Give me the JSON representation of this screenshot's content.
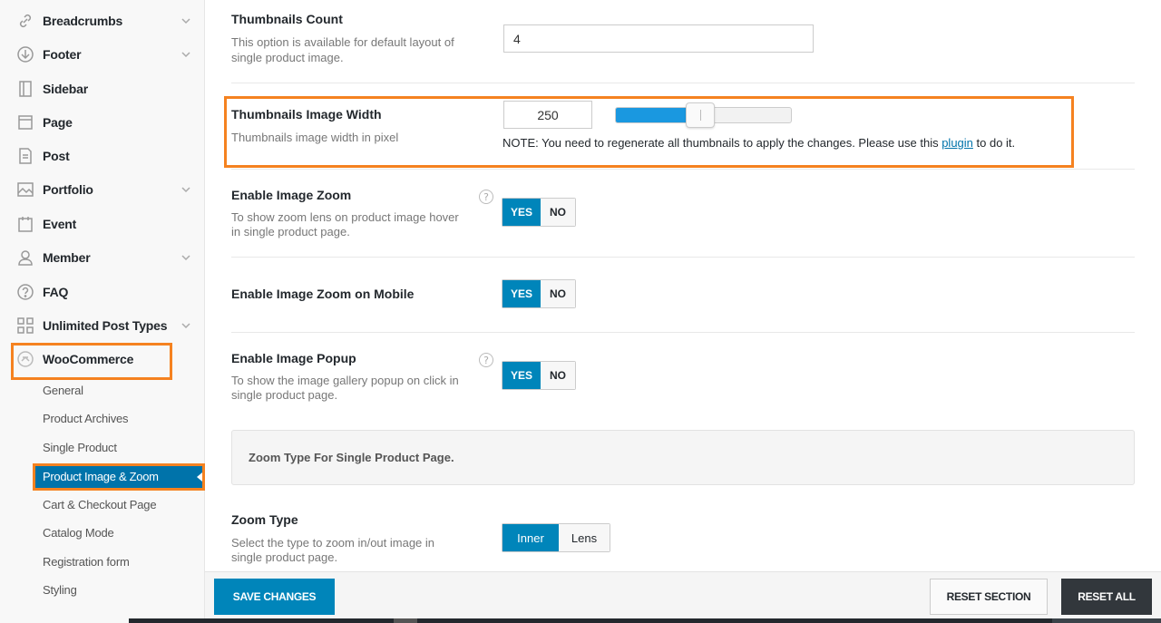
{
  "sidebar": {
    "items": [
      {
        "label": "Breadcrumbs",
        "icon": "link-icon",
        "has_chevron": true
      },
      {
        "label": "Footer",
        "icon": "arrow-down-circle-icon",
        "has_chevron": true
      },
      {
        "label": "Sidebar",
        "icon": "sidebar-icon",
        "has_chevron": false
      },
      {
        "label": "Page",
        "icon": "page-icon",
        "has_chevron": false
      },
      {
        "label": "Post",
        "icon": "post-icon",
        "has_chevron": false
      },
      {
        "label": "Portfolio",
        "icon": "image-icon",
        "has_chevron": true
      },
      {
        "label": "Event",
        "icon": "calendar-icon",
        "has_chevron": false
      },
      {
        "label": "Member",
        "icon": "user-icon",
        "has_chevron": true
      },
      {
        "label": "FAQ",
        "icon": "question-circle-icon",
        "has_chevron": false
      },
      {
        "label": "Unlimited Post Types",
        "icon": "grid-icon",
        "has_chevron": true
      },
      {
        "label": "WooCommerce",
        "icon": "woocommerce-icon",
        "has_chevron": false
      }
    ],
    "subitems": [
      "General",
      "Product Archives",
      "Single Product",
      "Product Image & Zoom",
      "Cart & Checkout Page",
      "Catalog Mode",
      "Registration form",
      "Styling"
    ],
    "active_subitem": "Product Image & Zoom"
  },
  "main": {
    "thumbnails_count": {
      "title": "Thumbnails Count",
      "desc_line1": "This option is available for default layout of",
      "desc_line2": "single product image.",
      "value": "4"
    },
    "thumbnails_width": {
      "title": "Thumbnails Image Width",
      "desc": "Thumbnails image width in pixel",
      "value": "250",
      "slider_fraction": 0.42,
      "note_prefix": "NOTE: You need to regenerate all thumbnails to apply the changes. Please use this ",
      "note_link": "plugin",
      "note_suffix": " to do it."
    },
    "image_zoom": {
      "title": "Enable Image Zoom",
      "desc_line1": "To show zoom lens on product image hover",
      "desc_line2": "in single product page.",
      "yes": "YES",
      "no": "NO",
      "selected": "YES"
    },
    "image_zoom_mobile": {
      "title": "Enable Image Zoom on Mobile",
      "yes": "YES",
      "no": "NO",
      "selected": "YES"
    },
    "image_popup": {
      "title": "Enable Image Popup",
      "desc_line1": "To show the image gallery popup on click in",
      "desc_line2": "single product page.",
      "yes": "YES",
      "no": "NO",
      "selected": "YES"
    },
    "section_heading": "Zoom Type For Single Product Page.",
    "zoom_type": {
      "title": "Zoom Type",
      "desc_line1": "Select the type to zoom in/out image in",
      "desc_line2": "single product page.",
      "options": [
        "Inner",
        "Lens"
      ],
      "selected": "Inner"
    },
    "help_glyph": "?"
  },
  "footer": {
    "save": "SAVE CHANGES",
    "reset_section": "RESET SECTION",
    "reset_all": "RESET ALL"
  },
  "colors": {
    "accent": "#0085ba",
    "highlight": "#f58220",
    "slider": "#1a98e0"
  }
}
